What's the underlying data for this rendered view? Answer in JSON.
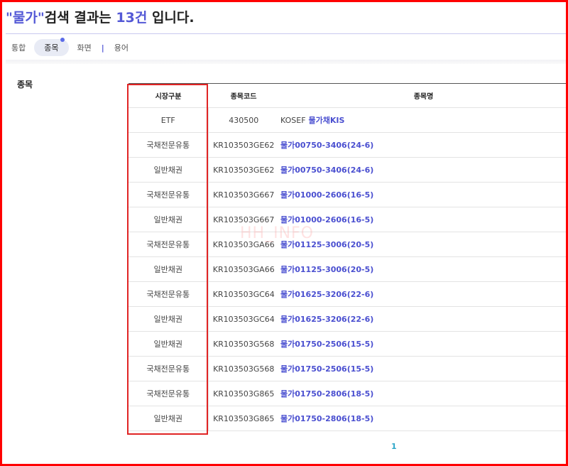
{
  "heading": {
    "keyword": "\"물가\"",
    "middle": "검색 결과는 ",
    "count": "13건",
    "suffix": " 입니다."
  },
  "tabs": [
    {
      "label": "통합",
      "active": false
    },
    {
      "label": "종목",
      "active": true
    },
    {
      "label": "화면",
      "active": false
    },
    {
      "label": "용어",
      "active": false
    }
  ],
  "tab_separator": "|",
  "section": {
    "title": "종목"
  },
  "table": {
    "headers": [
      "시장구분",
      "종목코드",
      "종목명"
    ],
    "rows": [
      {
        "market": "ETF",
        "code": "430500",
        "prefix": "KOSEF",
        "name": "물가채KIS"
      },
      {
        "market": "국채전문유통",
        "code": "KR103503GE62",
        "prefix": "",
        "name": "물가00750-3406(24-6)"
      },
      {
        "market": "일반채권",
        "code": "KR103503GE62",
        "prefix": "",
        "name": "물가00750-3406(24-6)"
      },
      {
        "market": "국채전문유통",
        "code": "KR103503G667",
        "prefix": "",
        "name": "물가01000-2606(16-5)"
      },
      {
        "market": "일반채권",
        "code": "KR103503G667",
        "prefix": "",
        "name": "물가01000-2606(16-5)"
      },
      {
        "market": "국채전문유통",
        "code": "KR103503GA66",
        "prefix": "",
        "name": "물가01125-3006(20-5)"
      },
      {
        "market": "일반채권",
        "code": "KR103503GA66",
        "prefix": "",
        "name": "물가01125-3006(20-5)"
      },
      {
        "market": "국채전문유통",
        "code": "KR103503GC64",
        "prefix": "",
        "name": "물가01625-3206(22-6)"
      },
      {
        "market": "일반채권",
        "code": "KR103503GC64",
        "prefix": "",
        "name": "물가01625-3206(22-6)"
      },
      {
        "market": "일반채권",
        "code": "KR103503G568",
        "prefix": "",
        "name": "물가01750-2506(15-5)"
      },
      {
        "market": "국채전문유통",
        "code": "KR103503G568",
        "prefix": "",
        "name": "물가01750-2506(15-5)"
      },
      {
        "market": "국채전문유통",
        "code": "KR103503G865",
        "prefix": "",
        "name": "물가01750-2806(18-5)"
      },
      {
        "market": "일반채권",
        "code": "KR103503G865",
        "prefix": "",
        "name": "물가01750-2806(18-5)"
      }
    ]
  },
  "pagination": {
    "current": "1"
  },
  "watermark": "HH_INFO",
  "colors": {
    "accent": "#5459d6",
    "link": "#4a4fd0",
    "highlight": "#e02424",
    "page": "#2fa7c9"
  }
}
